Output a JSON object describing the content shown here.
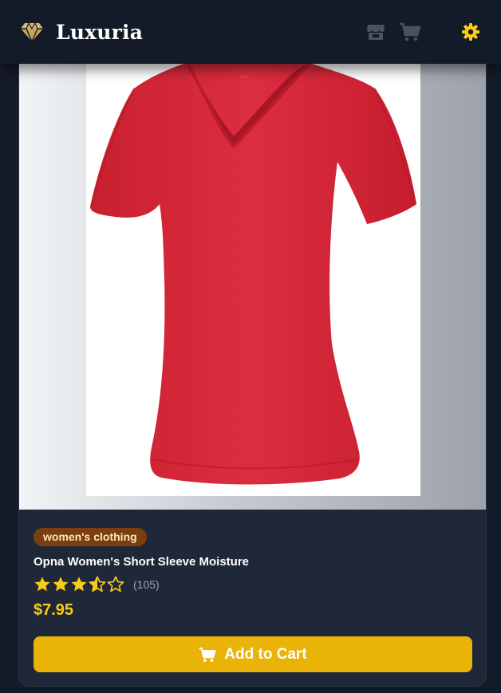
{
  "header": {
    "brand_name": "Luxuria",
    "logo_icon": "diamond-icon",
    "nav_icons": [
      "store-icon",
      "cart-icon",
      "settings-icon"
    ]
  },
  "product": {
    "category": "women's clothing",
    "title": "Opna Women's Short Sleeve Moisture",
    "rating_value": 3.5,
    "rating_max": 5,
    "rating_count": "(105)",
    "price": "$7.95",
    "image_subject": "red v-neck short sleeve t-shirt"
  },
  "actions": {
    "add_to_cart_label": "Add to Cart",
    "add_to_cart_icon": "cart-icon"
  },
  "colors": {
    "background": "#141b28",
    "card": "#1f2839",
    "accent": "#eab308",
    "price": "#facc15",
    "badge_bg": "#7a3e10",
    "badge_text": "#fde7b3",
    "star": "#facc15",
    "shirt": "#d22a3a"
  }
}
